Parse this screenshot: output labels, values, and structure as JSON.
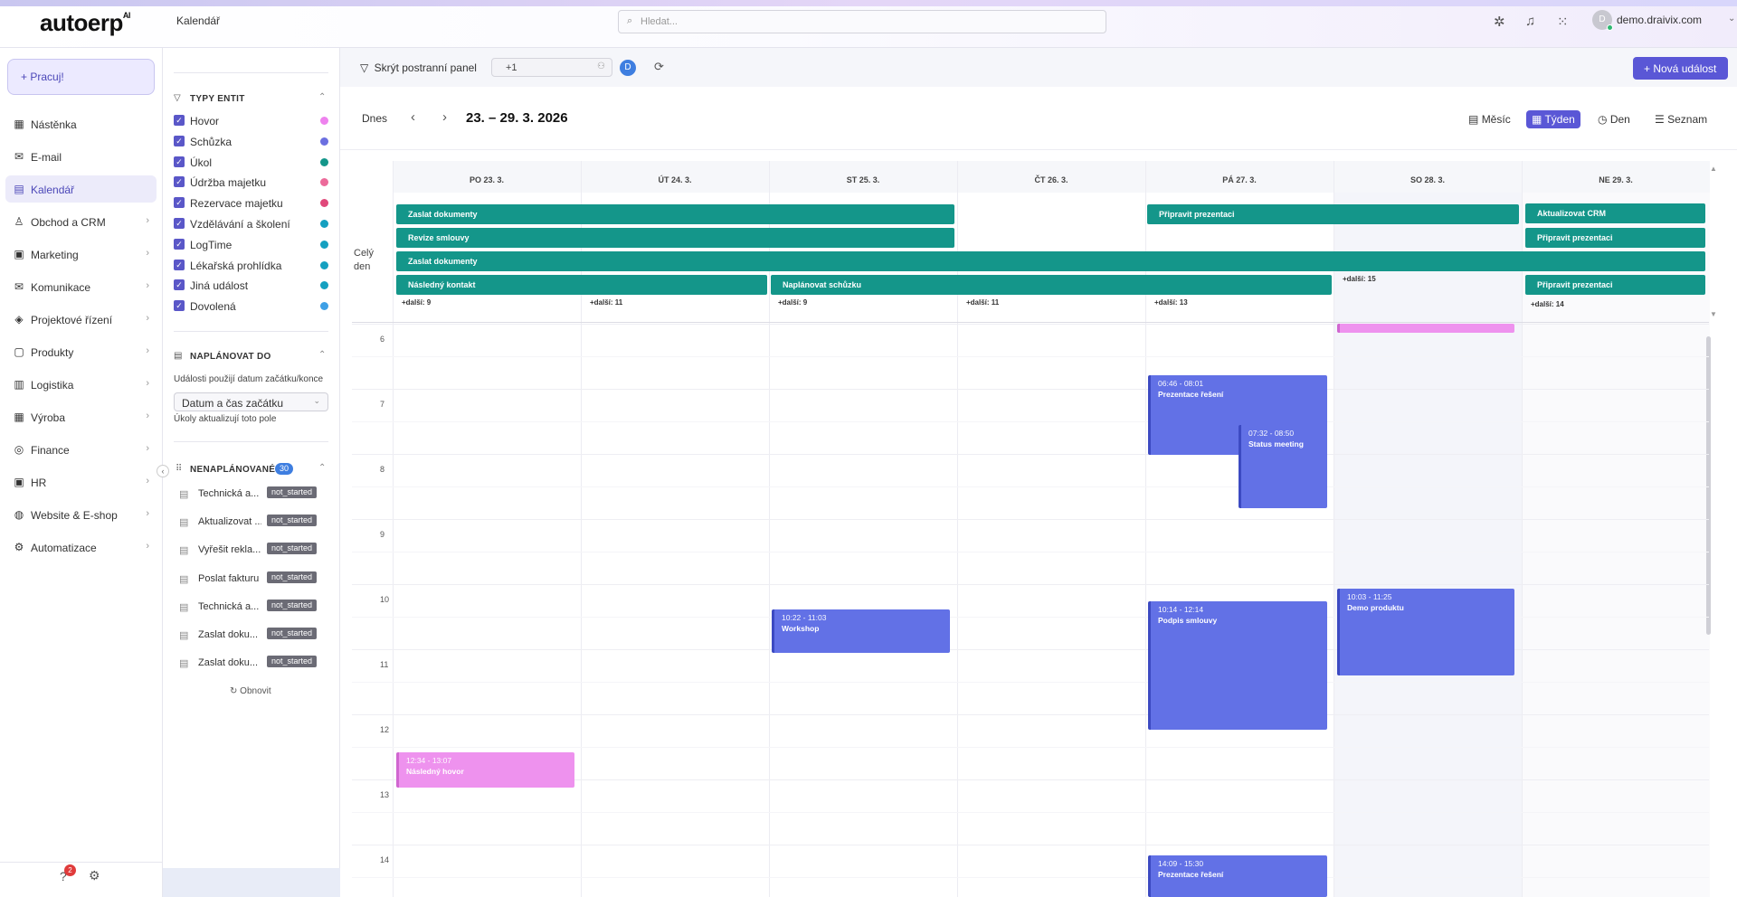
{
  "app": {
    "logo": "autoerp",
    "logo_sup": "AI",
    "breadcrumb": "Kalendář",
    "search_placeholder": "Hledat...",
    "user": "demo.draivix.com",
    "avatar_letter": "D"
  },
  "sidebar": {
    "primary": "+ Pracuj!",
    "items": [
      {
        "label": "Nástěnka",
        "icon": "dashboard-icon",
        "glyph": "▦",
        "chev": ""
      },
      {
        "label": "E-mail",
        "icon": "mail-icon",
        "glyph": "✉",
        "chev": ""
      },
      {
        "label": "Kalendář",
        "icon": "calendar-icon",
        "glyph": "▤",
        "chev": ""
      },
      {
        "label": "Obchod a CRM",
        "icon": "user-icon",
        "glyph": "♙",
        "chev": "›"
      },
      {
        "label": "Marketing",
        "icon": "marketing-icon",
        "glyph": "▣",
        "chev": "›"
      },
      {
        "label": "Komunikace",
        "icon": "chat-icon",
        "glyph": "✉",
        "chev": "›"
      },
      {
        "label": "Projektové řízení",
        "icon": "project-icon",
        "glyph": "◈",
        "chev": "›"
      },
      {
        "label": "Produkty",
        "icon": "box-icon",
        "glyph": "▢",
        "chev": "›"
      },
      {
        "label": "Logistika",
        "icon": "truck-icon",
        "glyph": "▥",
        "chev": "›"
      },
      {
        "label": "Výroba",
        "icon": "factory-icon",
        "glyph": "▦",
        "chev": "›"
      },
      {
        "label": "Finance",
        "icon": "money-icon",
        "glyph": "◎",
        "chev": "›"
      },
      {
        "label": "HR",
        "icon": "hr-icon",
        "glyph": "▣",
        "chev": "›"
      },
      {
        "label": "Website & E-shop",
        "icon": "globe-icon",
        "glyph": "◍",
        "chev": "›"
      },
      {
        "label": "Automatizace",
        "icon": "gear-icon",
        "glyph": "⚙",
        "chev": "›"
      }
    ],
    "notif_count": "2"
  },
  "filters": {
    "types_title": "TYPY ENTIT",
    "types": [
      {
        "label": "Hovor",
        "color": "#ee82ee"
      },
      {
        "label": "Schůzka",
        "color": "#6b6fe0"
      },
      {
        "label": "Úkol",
        "color": "#14968a"
      },
      {
        "label": "Údržba majetku",
        "color": "#ec6a9a"
      },
      {
        "label": "Rezervace majetku",
        "color": "#e0487a"
      },
      {
        "label": "Vzdělávání a školení",
        "color": "#14a0c0"
      },
      {
        "label": "LogTime",
        "color": "#14a0c0"
      },
      {
        "label": "Lékařská prohlídka",
        "color": "#14a0c0"
      },
      {
        "label": "Jiná událost",
        "color": "#14a0c0"
      },
      {
        "label": "Dovolená",
        "color": "#3ea0e6"
      }
    ],
    "plan_title": "NAPLÁNOVAT DO",
    "plan_hint": "Události použijí datum začátku/konce",
    "plan_select": "Datum a čas začátku",
    "plan_hint2": "Úkoly aktualizují toto pole",
    "unplanned_title": "NENAPLÁNOVANÉ",
    "unplanned_count": "30",
    "unplanned": [
      {
        "name": "Technická a...",
        "status": "not_started"
      },
      {
        "name": "Aktualizovat ...",
        "status": "not_started"
      },
      {
        "name": "Vyřešit rekla...",
        "status": "not_started"
      },
      {
        "name": "Poslat fakturu",
        "status": "not_started"
      },
      {
        "name": "Technická a...",
        "status": "not_started"
      },
      {
        "name": "Zaslat doku...",
        "status": "not_started"
      },
      {
        "name": "Zaslat doku...",
        "status": "not_started"
      }
    ],
    "refresh": "Obnovit"
  },
  "toolbar": {
    "hide_panel": "Skrýt postranní panel",
    "attendees": "+1",
    "attendee_letter": "D",
    "new_event": "+ Nová událost"
  },
  "calendar": {
    "today": "Dnes",
    "range": "23. – 29. 3. 2026",
    "views": [
      "Měsíc",
      "Týden",
      "Den",
      "Seznam"
    ],
    "allday_label": "Celý den",
    "days": [
      "PO 23. 3.",
      "ÚT 24. 3.",
      "ST 25. 3.",
      "ČT 26. 3.",
      "PÁ 27. 3.",
      "SO 28. 3.",
      "NE 29. 3."
    ],
    "allday_events": [
      "Zaslat dokumenty",
      "Revize smlouvy",
      "Zaslat dokumenty",
      "Následný kontakt",
      "Naplánovat schůzku",
      "Připravit prezentaci",
      "Aktualizovat CRM",
      "Připravit prezentaci",
      "Připravit prezentaci"
    ],
    "more": [
      "+další: 9",
      "+další: 11",
      "+další: 9",
      "+další: 11",
      "+další: 13",
      "+další: 15",
      "+další: 14"
    ],
    "hours": [
      "6",
      "7",
      "8",
      "9",
      "10",
      "11",
      "12",
      "13",
      "14"
    ],
    "events": [
      {
        "time": "06:46 - 08:01",
        "title": "Prezentace řešení"
      },
      {
        "time": "07:32 - 08:50",
        "title": "Status meeting"
      },
      {
        "time": "10:22 - 11:03",
        "title": "Workshop"
      },
      {
        "time": "10:14 - 12:14",
        "title": "Podpis smlouvy"
      },
      {
        "time": "10:03 - 11:25",
        "title": "Demo produktu"
      },
      {
        "time": "12:34 - 13:07",
        "title": "Následný hovor"
      },
      {
        "time": "14:09 - 15:30",
        "title": "Prezentace řešení"
      }
    ]
  }
}
